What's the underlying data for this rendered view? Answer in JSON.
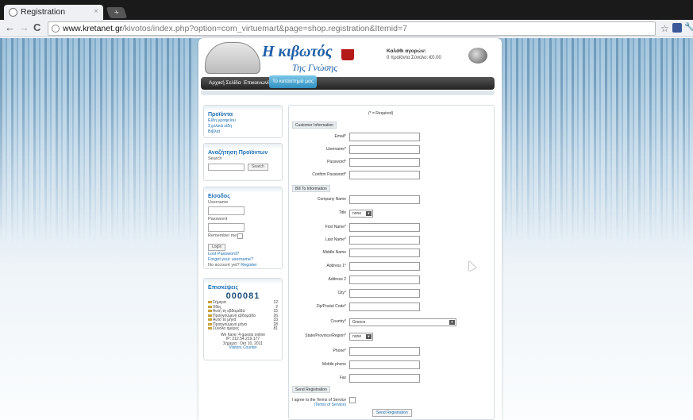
{
  "browser": {
    "tab_title": "Registration",
    "tab_close": "×",
    "newtab": "+",
    "url_domain": "www.kretanet.gr",
    "url_path": "/kivotos/index.php?option=com_virtuemart&page=shop.registration&Itemid=7",
    "back": "←",
    "forward": "→",
    "reload": "C",
    "star": "☆",
    "wrench": "🔧"
  },
  "header": {
    "title": "Η κιβωτός",
    "subtitle": "Της Γνώσης",
    "cart_title": "Καλάθι αγορών:",
    "cart_info": "0 προϊόντα   Σύνολο: €0.00"
  },
  "nav": {
    "items": [
      "Αρχική Σελίδα",
      "Επικοινωνία",
      "Το κατάστημά μας"
    ]
  },
  "products": {
    "title": "Προϊόντα",
    "links": [
      "Είδη γραφείου",
      "Σχολικά είδη",
      "Βιβλία"
    ]
  },
  "search": {
    "title": "Αναζήτηση Προϊόντων",
    "label": "Search",
    "button": "Search"
  },
  "login": {
    "title": "Είσοδος",
    "username_label": "Username",
    "password_label": "Password",
    "remember_label": "Remember me",
    "button": "Login",
    "lost_password": "Lost Password?",
    "forgot_username": "Forgot your username?",
    "no_account": "No account yet?",
    "register": "Register"
  },
  "visitors": {
    "title": "Επισκέψεις",
    "count": "000081",
    "rows": [
      {
        "label": "Σήμερα",
        "value": "12"
      },
      {
        "label": "Χθες",
        "value": "2"
      },
      {
        "label": "Αυτή τη εβδομάδα",
        "value": "15"
      },
      {
        "label": "Προηγούμενη εβδομάδα",
        "value": "26"
      },
      {
        "label": "Αυτό το μήνα",
        "value": "33"
      },
      {
        "label": "Προηγούμενο μήνα",
        "value": "28"
      },
      {
        "label": "Σύνολο ημέρες",
        "value": "81"
      }
    ],
    "online": "We have: 4 guests online",
    "ip": "IP: 212.54.219.177",
    "date": "Σήμερα : Οκτ 10, 2011",
    "counter_link": "Visitors Counter"
  },
  "form": {
    "required_note": "(* = Required)",
    "section_customer": "Customer Information",
    "email": "Email*",
    "username": "Username*",
    "password": "Password*",
    "confirm_password": "Confirm Password*",
    "section_billto": "Bill To Information",
    "company": "Company Name",
    "title_label": "Title",
    "title_value": "none",
    "first_name": "First Name*",
    "last_name": "Last Name*",
    "middle_name": "Middle Name",
    "address1": "Address 1*",
    "address2": "Address 2",
    "city": "City*",
    "zip": "Zip/Postal Code*",
    "country": "Country*",
    "country_value": "Greece",
    "state": "State/Province/Region*",
    "state_value": "none",
    "phone": "Phone*",
    "mobile": "Mobile phone",
    "fax": "Fax",
    "section_send": "Send Registration",
    "agree": "I agree to the Terms of Service",
    "tos_link": "(Terms of Service)",
    "send_button": "Send Registration"
  }
}
